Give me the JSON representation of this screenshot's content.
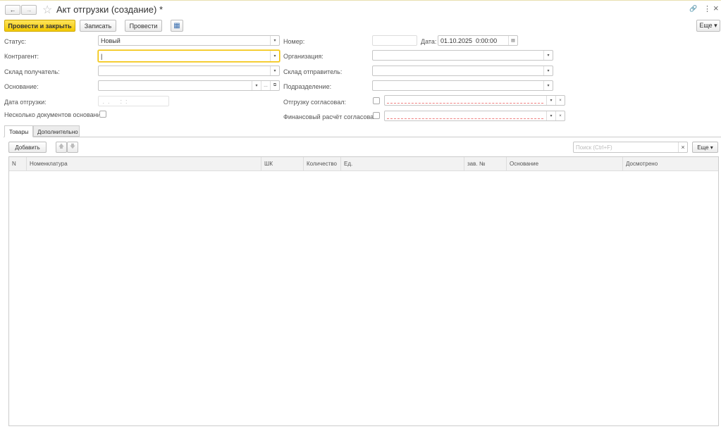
{
  "header": {
    "title": "Акт отгрузки (создание) *",
    "back": "←",
    "forward": "→",
    "star": "☆",
    "link": "🔗",
    "more": "⋮",
    "close": "×"
  },
  "toolbar": {
    "post_close": "Провести и закрыть",
    "save": "Записать",
    "post": "Провести",
    "more": "Еще ▾"
  },
  "form": {
    "status_label": "Статус:",
    "status_value": "Новый",
    "counterparty_label": "Контрагент:",
    "counterparty_value": "|",
    "recv_wh_label": "Склад получатель:",
    "basis_label": "Основание:",
    "ship_date_label": "Дата отгрузки:",
    "ship_date_value": " .  .      :  :",
    "multi_basis_label": "Несколько документов основания:",
    "number_label": "Номер:",
    "date_label": "Дата:",
    "date_value": "01.10.2025  0:00:00",
    "org_label": "Организация:",
    "send_wh_label": "Склад отправитель:",
    "dept_label": "Подразделение:",
    "ship_approved_label": "Отгрузку согласовал:",
    "fin_approved_label": "Финансовый расчёт согласовал:"
  },
  "tabs": [
    {
      "label": "Товары"
    },
    {
      "label": "Дополнительно"
    }
  ],
  "table_toolbar": {
    "add": "Добавить",
    "up": "🡅",
    "down": "🡇",
    "search_placeholder": "Поиск (Ctrl+F)",
    "clear": "×",
    "more": "Еще ▾"
  },
  "columns": [
    "N",
    "Номенклатура",
    "ШК",
    "Количество",
    "Ед.",
    "зав. №",
    "Основание",
    "Досмотрено"
  ]
}
